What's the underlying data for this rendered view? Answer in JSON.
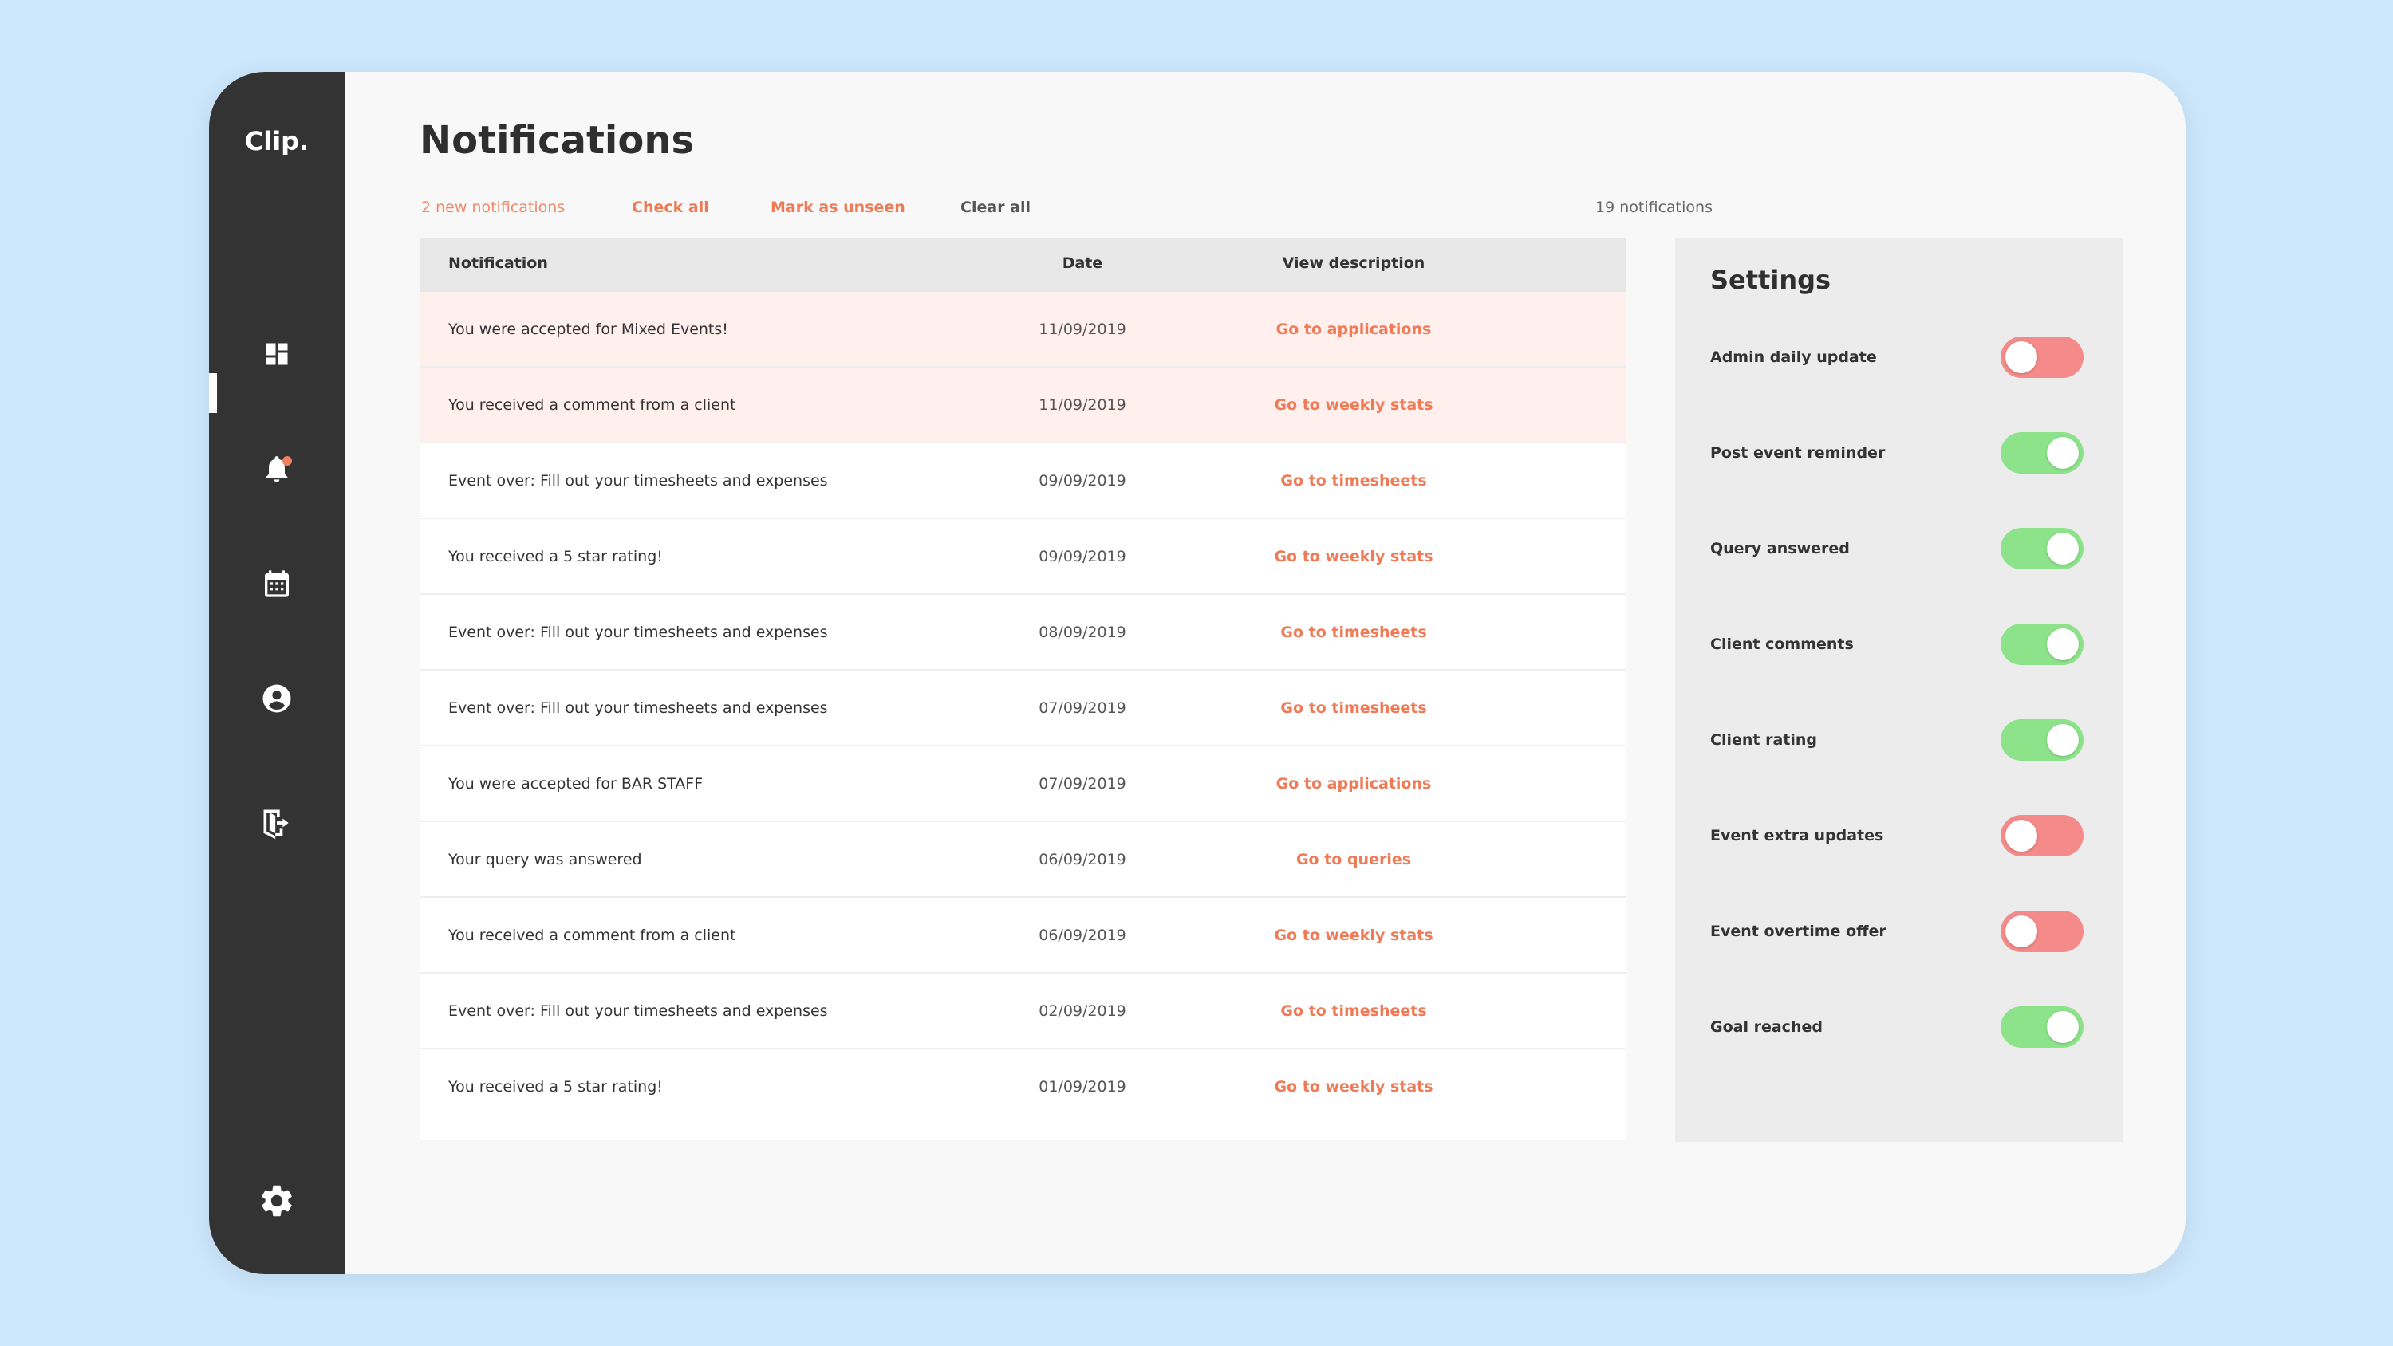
{
  "app": {
    "logo": "Clip."
  },
  "sidebar": {
    "items": [
      {
        "icon": "dashboard-icon"
      },
      {
        "icon": "bell-icon",
        "active": true,
        "has_badge": true
      },
      {
        "icon": "calendar-icon"
      },
      {
        "icon": "account-icon"
      },
      {
        "icon": "logout-icon"
      },
      {
        "icon": "gear-icon"
      }
    ]
  },
  "header": {
    "title": "Notifications"
  },
  "toolbar": {
    "new_count": "2 new notifications",
    "check_all": "Check all",
    "mark_unseen": "Mark as unseen",
    "clear_all": "Clear all",
    "total": "19 notifications"
  },
  "table": {
    "columns": [
      "Notification",
      "Date",
      "View description"
    ],
    "rows": [
      {
        "text": "You were accepted for Mixed Events!",
        "date": "11/09/2019",
        "link": "Go to applications",
        "new": true
      },
      {
        "text": "You received a comment from a client",
        "date": "11/09/2019",
        "link": "Go to weekly stats",
        "new": true
      },
      {
        "text": "Event over: Fill out your timesheets and expenses",
        "date": "09/09/2019",
        "link": "Go to timesheets",
        "new": false
      },
      {
        "text": "You received a 5 star rating!",
        "date": "09/09/2019",
        "link": "Go to weekly stats",
        "new": false
      },
      {
        "text": "Event over: Fill out your timesheets and expenses",
        "date": "08/09/2019",
        "link": "Go to timesheets",
        "new": false
      },
      {
        "text": "Event over: Fill out your timesheets and expenses",
        "date": "07/09/2019",
        "link": "Go to timesheets",
        "new": false
      },
      {
        "text": "You were accepted for BAR STAFF",
        "date": "07/09/2019",
        "link": "Go to applications",
        "new": false
      },
      {
        "text": "Your query was answered",
        "date": "06/09/2019",
        "link": "Go to queries",
        "new": false
      },
      {
        "text": "You received a comment from a client",
        "date": "06/09/2019",
        "link": "Go to weekly stats",
        "new": false
      },
      {
        "text": "Event over: Fill out your timesheets and expenses",
        "date": "02/09/2019",
        "link": "Go to timesheets",
        "new": false
      },
      {
        "text": "You received a 5 star rating!",
        "date": "01/09/2019",
        "link": "Go to weekly stats",
        "new": false
      }
    ]
  },
  "settings": {
    "title": "Settings",
    "items": [
      {
        "label": "Admin daily update",
        "enabled": false
      },
      {
        "label": "Post event reminder",
        "enabled": true
      },
      {
        "label": "Query answered",
        "enabled": true
      },
      {
        "label": "Client comments",
        "enabled": true
      },
      {
        "label": "Client rating",
        "enabled": true
      },
      {
        "label": "Event extra updates",
        "enabled": false
      },
      {
        "label": "Event overtime offer",
        "enabled": false
      },
      {
        "label": "Goal reached",
        "enabled": true
      }
    ]
  },
  "colors": {
    "accent": "#ef7a55",
    "sidebar": "#333333",
    "toggle_on": "#8de38a",
    "toggle_off": "#f48a8a",
    "new_row": "#fff0ee"
  }
}
